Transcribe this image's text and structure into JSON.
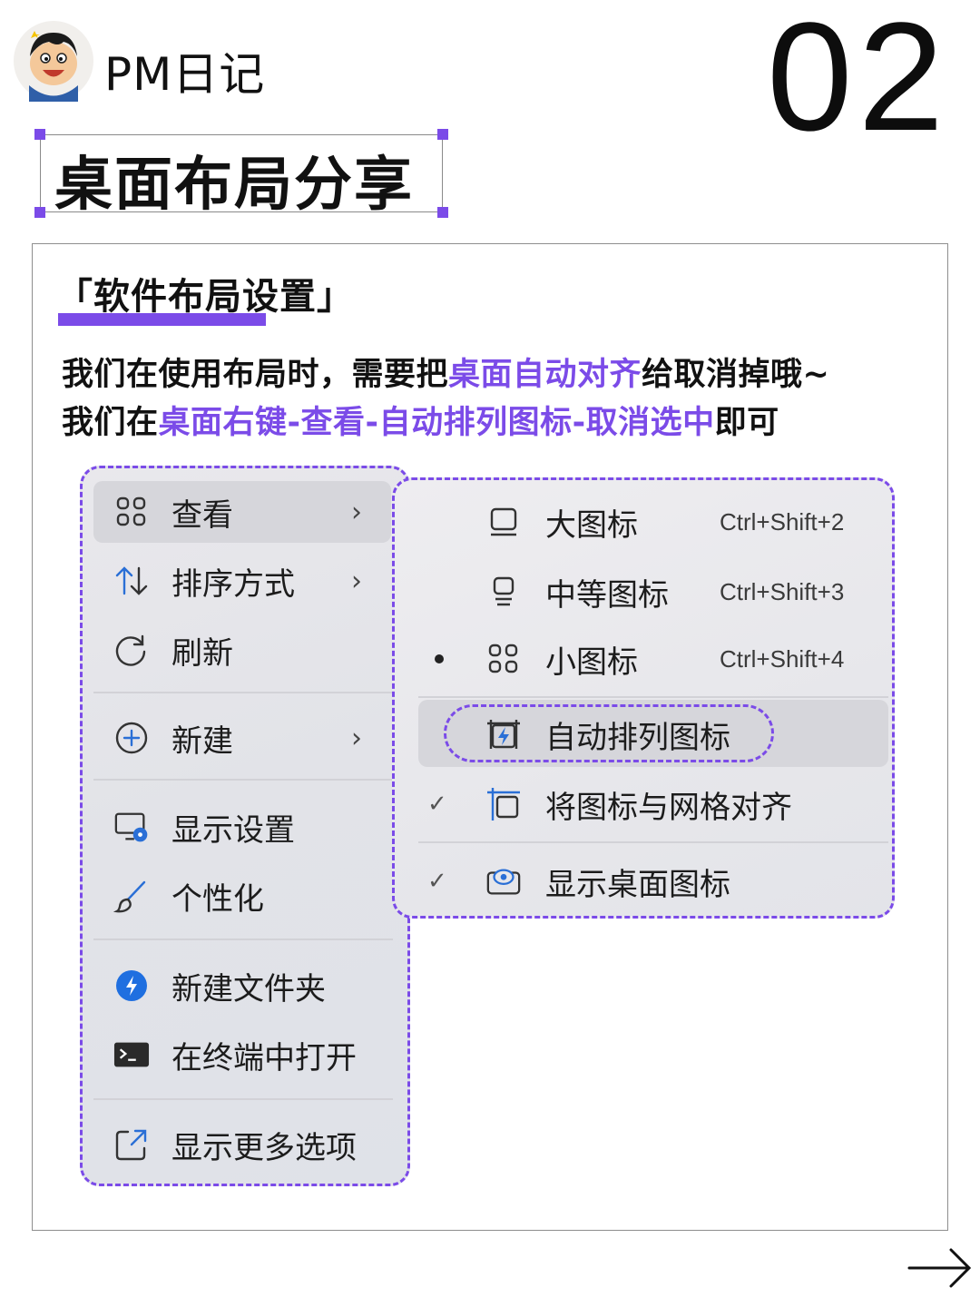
{
  "header": {
    "brand": "PM日记",
    "number": "02",
    "title": "桌面布局分享"
  },
  "section": {
    "title": "「软件布局设置」",
    "line1_a": "我们在使用布局时，需要把",
    "line1_hl": "桌面自动对齐",
    "line1_b": "给取消掉哦~",
    "line2_a": "我们在",
    "line2_hl": "桌面右键-查看-自动排列图标-取消选中",
    "line2_b": "即可"
  },
  "context_menu": {
    "items": [
      {
        "label": "查看",
        "icon": "grid-icon",
        "submenu": true
      },
      {
        "label": "排序方式",
        "icon": "sort-icon",
        "submenu": true
      },
      {
        "label": "刷新",
        "icon": "refresh-icon",
        "submenu": false
      },
      {
        "label": "新建",
        "icon": "plus-circle-icon",
        "submenu": true
      },
      {
        "label": "显示设置",
        "icon": "display-settings-icon",
        "submenu": false
      },
      {
        "label": "个性化",
        "icon": "brush-icon",
        "submenu": false
      },
      {
        "label": "新建文件夹",
        "icon": "lightning-circle-icon",
        "submenu": false
      },
      {
        "label": "在终端中打开",
        "icon": "terminal-icon",
        "submenu": false
      },
      {
        "label": "显示更多选项",
        "icon": "open-external-icon",
        "submenu": false
      }
    ],
    "chevron": "›"
  },
  "view_submenu": {
    "items": [
      {
        "label": "大图标",
        "shortcut": "Ctrl+Shift+2",
        "icon": "large-icon-icon",
        "state": ""
      },
      {
        "label": "中等图标",
        "shortcut": "Ctrl+Shift+3",
        "icon": "medium-icon-icon",
        "state": ""
      },
      {
        "label": "小图标",
        "shortcut": "Ctrl+Shift+4",
        "icon": "small-icons-icon",
        "state": "selected"
      },
      {
        "label": "自动排列图标",
        "shortcut": "",
        "icon": "auto-arrange-icon",
        "state": "highlighted"
      },
      {
        "label": "将图标与网格对齐",
        "shortcut": "",
        "icon": "align-grid-icon",
        "state": "checked"
      },
      {
        "label": "显示桌面图标",
        "shortcut": "",
        "icon": "show-desktop-icon",
        "state": "checked"
      }
    ],
    "check_glyph": "✓"
  },
  "colors": {
    "accent": "#7b4be8",
    "text": "#111111",
    "menu_bg": "#e4e4e9"
  },
  "footer": {
    "next_icon": "arrow-right-icon"
  }
}
